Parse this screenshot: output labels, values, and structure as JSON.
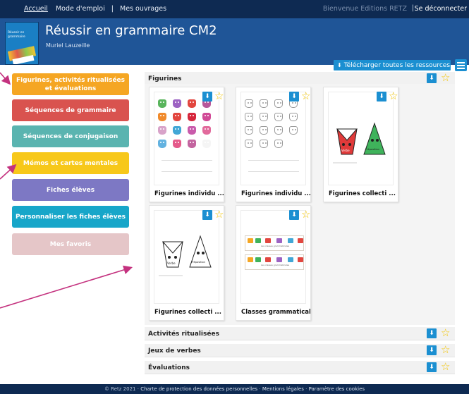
{
  "topnav": {
    "home": "Accueil",
    "manual": "Mode d'emploi",
    "works": "Mes ouvrages",
    "separator": "|",
    "welcome": "Bienvenue Editions RETZ",
    "logout": "Se déconnecter"
  },
  "header": {
    "title": "Réussir en grammaire CM2",
    "author": "Muriel Lauzeille",
    "cover_title": "Réussir en grammaire"
  },
  "toolbar": {
    "download_all": "Télécharger toutes les ressources",
    "download_icon": "download-icon",
    "list_icon": "list-icon"
  },
  "sidebar": {
    "items": [
      {
        "label": "Figurines, activités ritualisées et évaluations",
        "color": "#f5a623"
      },
      {
        "label": "Séquences de grammaire",
        "color": "#d9534f"
      },
      {
        "label": "Séquences de conjugaison",
        "color": "#5ab4b0"
      },
      {
        "label": "Mémos et cartes mentales",
        "color": "#f7c81a"
      },
      {
        "label": "Fiches élèves",
        "color": "#7d78c4"
      },
      {
        "label": "Personnaliser les fiches élèves",
        "color": "#17a6c9"
      },
      {
        "label": "Mes favoris",
        "color": "#e5c6c8"
      }
    ]
  },
  "sections": {
    "figurines": {
      "label": "Figurines"
    },
    "activites": {
      "label": "Activités ritualisées"
    },
    "verbes": {
      "label": "Jeux de verbes"
    },
    "evaluations": {
      "label": "Évaluations"
    }
  },
  "cards": [
    {
      "name": "Figurines individu ..."
    },
    {
      "name": "Figurines individu ..."
    },
    {
      "name": "Figurines collecti ..."
    },
    {
      "name": "Figurines collecti ..."
    },
    {
      "name": "Classes grammaticales"
    }
  ],
  "thumb_text": {
    "verbe": "Verbe",
    "preposition": "Préposition",
    "classes_heading": "Les classes grammaticales"
  },
  "colors": {
    "topnav": "#0e2a52",
    "header": "#1f5597",
    "accent": "#1b8fd1",
    "star": "#f2c400",
    "arrow": "#c4327f"
  },
  "footer": {
    "copyright": "© Retz 2021",
    "charter": "Charte de protection des données personnelles",
    "legal": "Mentions légales",
    "cookies": "Paramètre des cookies",
    "separator": "·"
  }
}
